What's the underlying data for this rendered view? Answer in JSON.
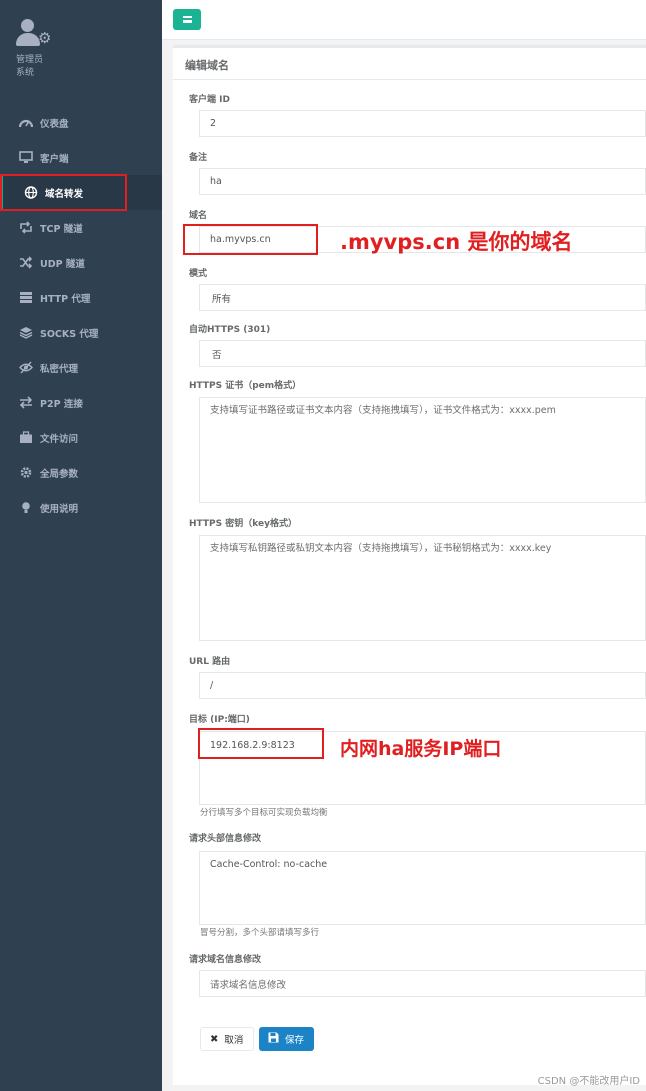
{
  "profile": {
    "name": "管理员",
    "role": "系统"
  },
  "sidebar": {
    "items": [
      {
        "label": "仪表盘",
        "icon": "dashboard-icon"
      },
      {
        "label": "客户端",
        "icon": "monitor-icon"
      },
      {
        "label": "域名转发",
        "icon": "globe-icon",
        "active": true
      },
      {
        "label": "TCP 隧道",
        "icon": "retweet-icon"
      },
      {
        "label": "UDP 隧道",
        "icon": "shuffle-icon"
      },
      {
        "label": "HTTP 代理",
        "icon": "server-icon"
      },
      {
        "label": "SOCKS 代理",
        "icon": "layers-icon"
      },
      {
        "label": "私密代理",
        "icon": "eye-slash-icon"
      },
      {
        "label": "P2P 连接",
        "icon": "exchange-icon"
      },
      {
        "label": "文件访问",
        "icon": "briefcase-icon"
      },
      {
        "label": "全局参数",
        "icon": "gear-icon"
      },
      {
        "label": "使用说明",
        "icon": "lightbulb-icon"
      }
    ]
  },
  "colors": {
    "sidebar": "#2f4050",
    "accent": "#1ab394",
    "primary": "#1c84c6",
    "annotation": "#e02020"
  },
  "form": {
    "title": "编辑域名",
    "client_id": {
      "label": "客户端 ID",
      "value": "2"
    },
    "remark": {
      "label": "备注",
      "value": "ha"
    },
    "domain": {
      "label": "域名",
      "value": "ha.myvps.cn"
    },
    "mode": {
      "label": "模式",
      "value": "所有"
    },
    "auto_https": {
      "label": "自动HTTPS (301)",
      "value": "否"
    },
    "https_cert": {
      "label": "HTTPS 证书（pem格式）",
      "placeholder": "支持填写证书路径或证书文本内容（支持拖拽填写），证书文件格式为：xxxx.pem"
    },
    "https_key": {
      "label": "HTTPS 密钥（key格式）",
      "placeholder": "支持填写私钥路径或私钥文本内容（支持拖拽填写），证书秘钥格式为：xxxx.key"
    },
    "url_route": {
      "label": "URL 路由",
      "value": "/"
    },
    "target": {
      "label": "目标 (IP:端口)",
      "value": "192.168.2.9:8123",
      "help": "分行填写多个目标可实现负载均衡"
    },
    "header_change": {
      "label": "请求头部信息修改",
      "value": "Cache-Control: no-cache",
      "help": "冒号分割，多个头部请填写多行"
    },
    "host_change": {
      "label": "请求域名信息修改",
      "placeholder": "请求域名信息修改"
    },
    "cancel_label": "取消",
    "save_label": "保存"
  },
  "annotations": {
    "domain_note": ".myvps.cn 是你的域名",
    "target_note": "内网ha服务IP端口"
  },
  "watermark": "CSDN @不能改用户ID"
}
